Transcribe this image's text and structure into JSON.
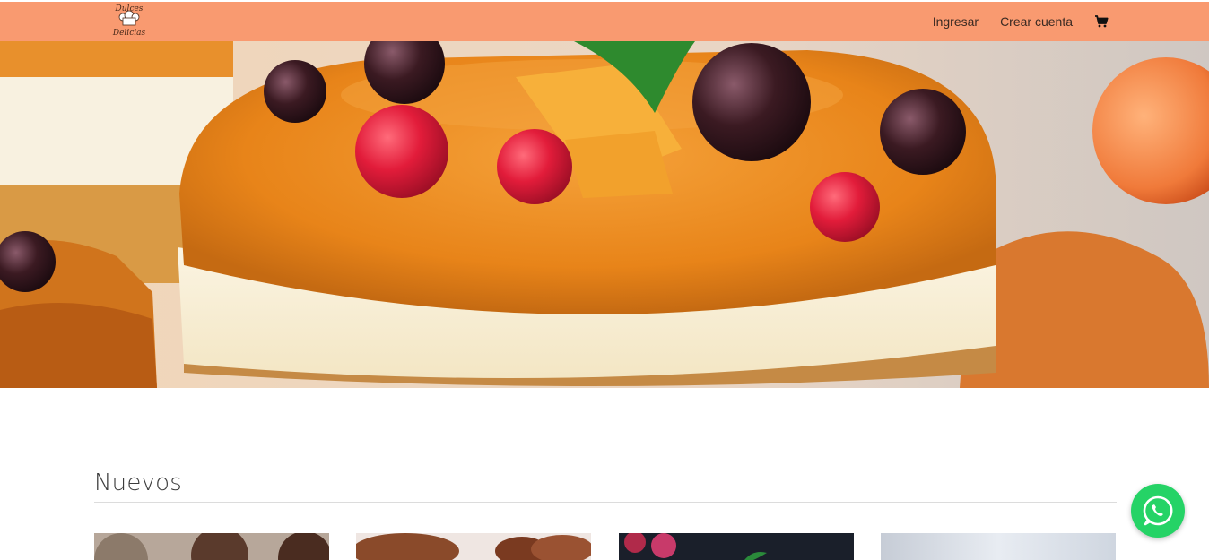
{
  "header": {
    "logo": {
      "line1": "Dulces",
      "line2": "Delicias"
    },
    "nav": {
      "login_label": "Ingresar",
      "register_label": "Crear cuenta",
      "cart_icon": "shopping-cart-icon"
    },
    "background_color": "#f99a70"
  },
  "hero": {
    "image_description_icon": "dessert-photo"
  },
  "section": {
    "title": "Nuevos",
    "products": [
      {
        "image": "chocolate-cookies-photo"
      },
      {
        "image": "chocolate-cupcakes-photo"
      },
      {
        "image": "dark-dessert-photo"
      },
      {
        "image": "light-dessert-photo"
      }
    ]
  },
  "whatsapp": {
    "icon": "whatsapp-icon",
    "color": "#25d366"
  }
}
